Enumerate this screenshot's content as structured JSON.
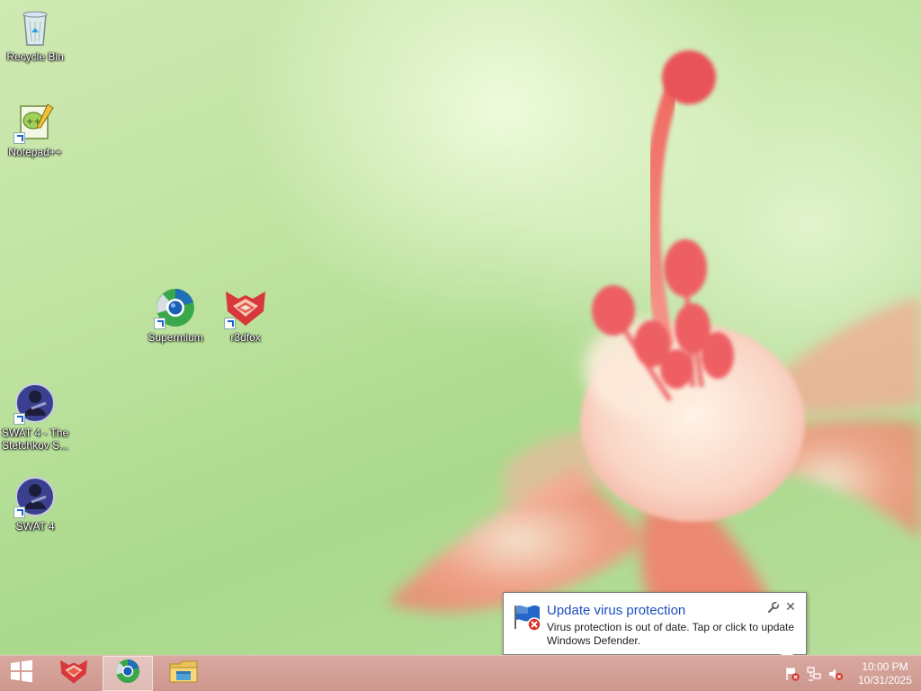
{
  "desktop": {
    "icons": [
      {
        "label": "Recycle Bin",
        "icon": "recycle-bin-icon"
      },
      {
        "label": "Notepad++",
        "icon": "notepad-plus-plus-icon"
      },
      {
        "label": "Supermium",
        "icon": "supermium-browser-icon"
      },
      {
        "label": "r3dfox",
        "icon": "r3dfox-browser-icon"
      },
      {
        "label": "SWAT 4 - The Stetchkov S...",
        "icon": "swat4-game-icon"
      },
      {
        "label": "SWAT 4",
        "icon": "swat4-game-icon"
      }
    ]
  },
  "notification": {
    "title": "Update virus protection",
    "message": "Virus protection is out of date. Tap or click to update Windows Defender.",
    "icon": "windows-defender-flag-error-icon",
    "title_color": "#1b4fbf"
  },
  "taskbar": {
    "start_icon": "windows-logo-icon",
    "pinned": [
      {
        "name": "r3dfox",
        "icon": "r3dfox-browser-icon",
        "active": false
      },
      {
        "name": "Supermium",
        "icon": "supermium-browser-icon",
        "active": true
      },
      {
        "name": "File Explorer",
        "icon": "file-explorer-icon",
        "active": false
      }
    ],
    "tray": {
      "icons": [
        "action-center-flag-error-icon",
        "network-icon",
        "volume-muted-icon"
      ],
      "time": "10:00 PM",
      "date": "10/31/2025"
    },
    "color": "#d4a099"
  }
}
